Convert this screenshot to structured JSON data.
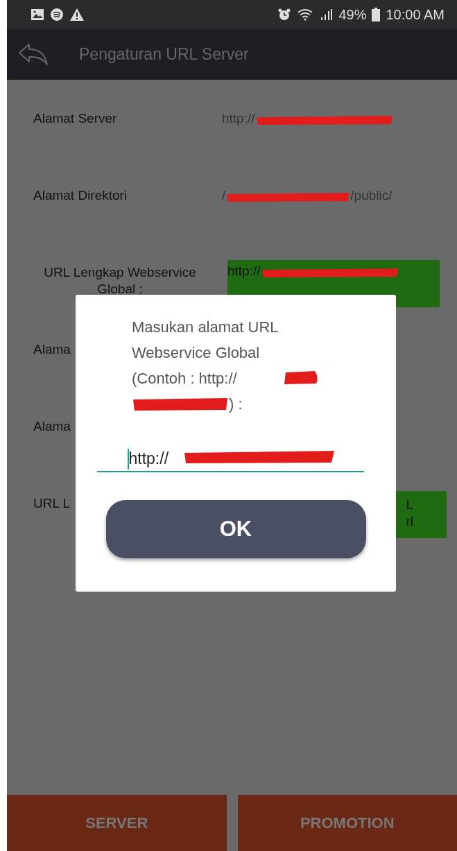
{
  "status_bar": {
    "battery": "49%",
    "time": "10:00 AM"
  },
  "app_bar": {
    "title": "Pengaturan URL Server"
  },
  "settings": [
    {
      "label": "Alamat Server",
      "lines": [
        "http://"
      ],
      "highlighted": false,
      "redacted": true
    },
    {
      "label": "Alamat Direktori",
      "lines": [
        "/",
        "/public/"
      ],
      "highlighted": false,
      "redacted": true
    },
    {
      "label": "URL Lengkap Webservice Global :",
      "lines": [
        "http://"
      ],
      "highlighted": true,
      "redacted": true
    },
    {
      "label": "Alama"
    },
    {
      "label": "Alama"
    },
    {
      "label": "URL L",
      "lines": [
        "L",
        "rl"
      ],
      "highlighted": true
    }
  ],
  "dialog": {
    "message_start": "Masukan alamat URL Webservice Global (Contoh : http://",
    "message_end": ") :",
    "input_value": "http://",
    "input_redacted": true,
    "button": "OK"
  },
  "bottom_buttons": [
    "SERVER",
    "PROMOTION"
  ]
}
